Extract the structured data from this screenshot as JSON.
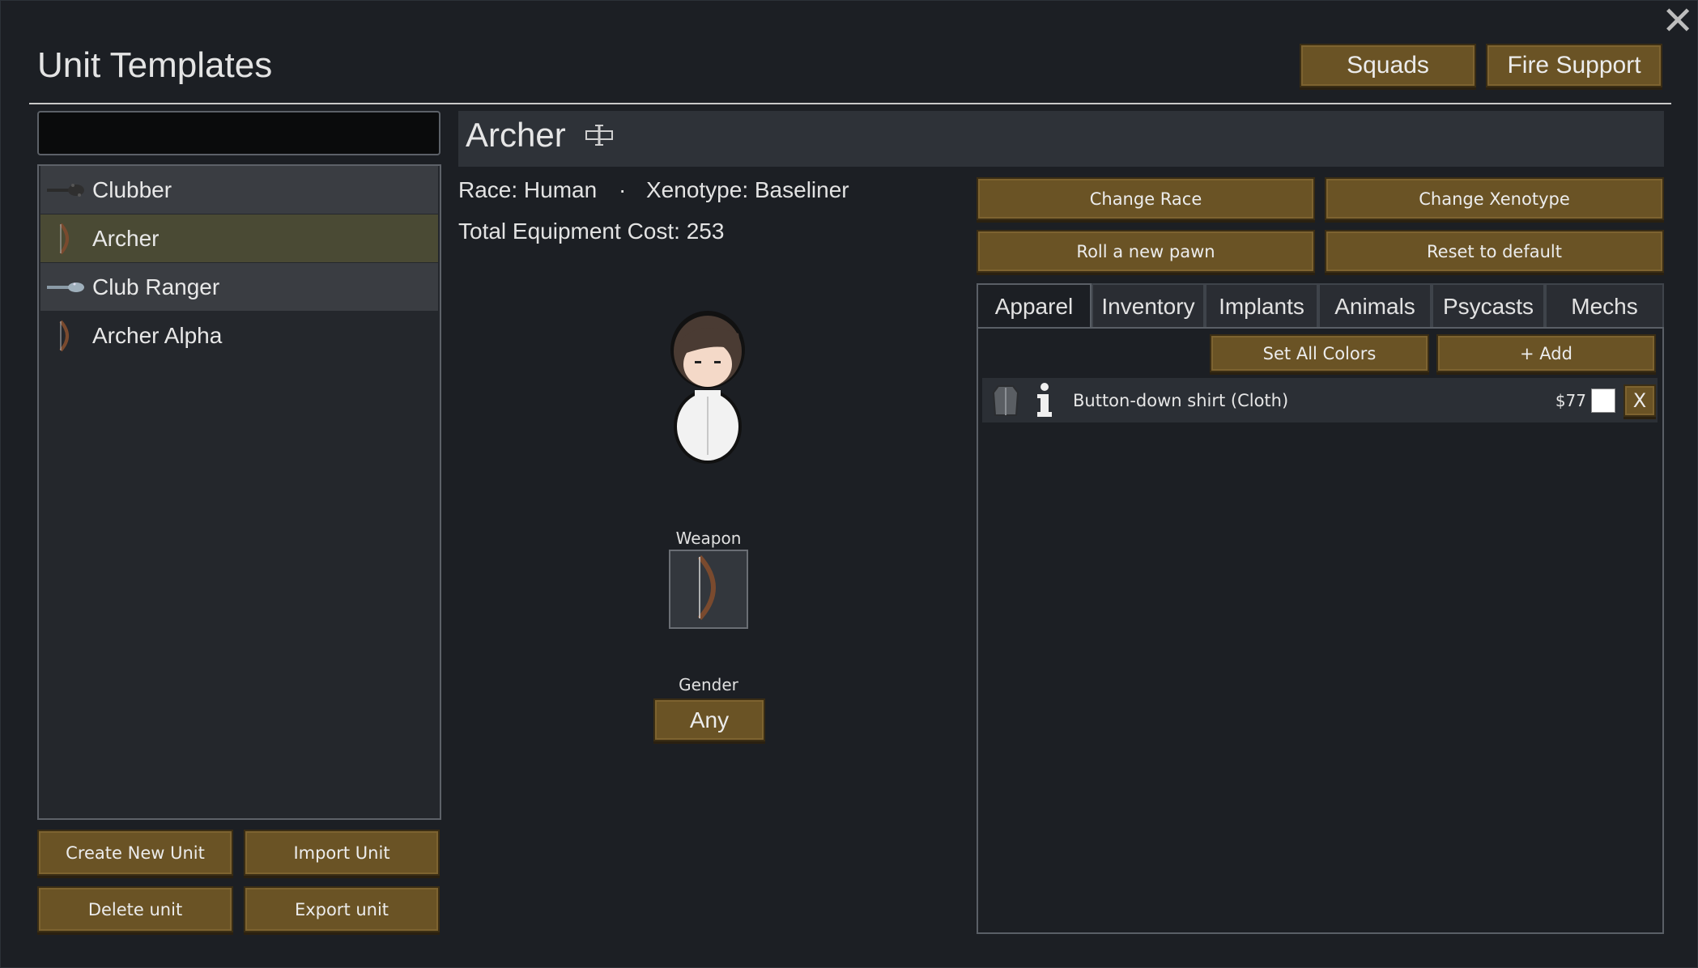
{
  "window": {
    "title": "Unit Templates",
    "close_icon": "close-icon"
  },
  "top_buttons": {
    "squads": "Squads",
    "fire_support": "Fire Support"
  },
  "search": {
    "value": "",
    "placeholder": ""
  },
  "unit_list": [
    {
      "label": "Clubber",
      "icon": "club-icon",
      "selected": false
    },
    {
      "label": "Archer",
      "icon": "bow-icon",
      "selected": true
    },
    {
      "label": "Club Ranger",
      "icon": "club-icon",
      "selected": false
    },
    {
      "label": "Archer Alpha",
      "icon": "bow-icon",
      "selected": false
    }
  ],
  "list_buttons": {
    "create": "Create New Unit",
    "import": "Import Unit",
    "delete": "Delete unit",
    "export": "Export unit"
  },
  "unit": {
    "name": "Archer",
    "race": "Race: Human",
    "separator": "·",
    "xenotype": "Xenotype: Baseliner",
    "cost": "Total Equipment Cost: 253",
    "weapon_label": "Weapon",
    "gender_label": "Gender",
    "gender_value": "Any"
  },
  "actions": {
    "change_race": "Change Race",
    "change_xenotype": "Change Xenotype",
    "roll_pawn": "Roll a new pawn",
    "reset": "Reset to default"
  },
  "tabs": [
    {
      "label": "Apparel",
      "active": true
    },
    {
      "label": "Inventory",
      "active": false
    },
    {
      "label": "Implants",
      "active": false
    },
    {
      "label": "Animals",
      "active": false
    },
    {
      "label": "Psycasts",
      "active": false
    },
    {
      "label": "Mechs",
      "active": false
    }
  ],
  "apparel": {
    "set_all_colors": "Set All Colors",
    "add": "+ Add",
    "items": [
      {
        "name": "Button-down shirt (Cloth)",
        "price": "$77",
        "remove": "X",
        "color": "#ffffff"
      }
    ]
  },
  "colors": {
    "button": "#6a5325",
    "selected_row": "#4a4a34",
    "background": "#1c1f24"
  }
}
